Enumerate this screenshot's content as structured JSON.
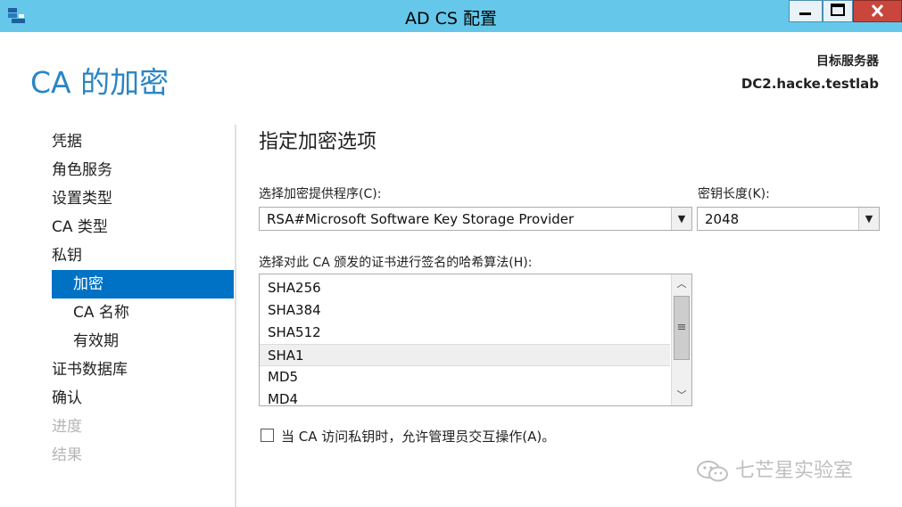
{
  "window": {
    "title": "AD CS 配置",
    "colors": {
      "titlebar": "#65c8ea",
      "close_button": "#c9463d",
      "accent": "#0072c6",
      "heading": "#2a85c4"
    }
  },
  "header": {
    "heading": "CA 的加密",
    "target_label": "目标服务器",
    "target_value": "DC2.hacke.testlab"
  },
  "nav": {
    "items": [
      {
        "label": "凭据",
        "state": "normal"
      },
      {
        "label": "角色服务",
        "state": "normal"
      },
      {
        "label": "设置类型",
        "state": "normal"
      },
      {
        "label": "CA 类型",
        "state": "normal"
      },
      {
        "label": "私钥",
        "state": "normal"
      },
      {
        "label": "加密",
        "state": "active"
      },
      {
        "label": "CA 名称",
        "state": "normal"
      },
      {
        "label": "有效期",
        "state": "normal"
      },
      {
        "label": "证书数据库",
        "state": "normal"
      },
      {
        "label": "确认",
        "state": "normal"
      },
      {
        "label": "进度",
        "state": "disabled"
      },
      {
        "label": "结果",
        "state": "disabled"
      }
    ]
  },
  "main": {
    "section_title": "指定加密选项",
    "provider_label": "选择加密提供程序(C):",
    "provider_value": "RSA#Microsoft Software Key Storage Provider",
    "key_length_label": "密钥长度(K):",
    "key_length_value": "2048",
    "hash_label": "选择对此 CA 颁发的证书进行签名的哈希算法(H):",
    "hash_options": [
      "SHA256",
      "SHA384",
      "SHA512",
      "SHA1",
      "MD5",
      "MD4"
    ],
    "hash_selected": "SHA1",
    "allow_interaction_label": "当 CA 访问私钥时，允许管理员交互操作(A)。",
    "allow_interaction_checked": false
  },
  "watermark": {
    "text": "七芒星实验室"
  }
}
